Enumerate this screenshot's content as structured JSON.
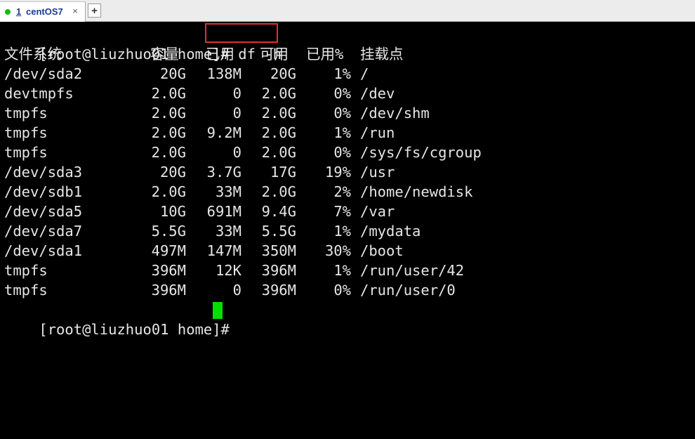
{
  "tab": {
    "number": "1",
    "title": "centOS7",
    "close_glyph": "×",
    "add_glyph": "+",
    "status_color": "#18b818"
  },
  "terminal": {
    "prompt": "[root@liuzhuo01 home]#",
    "command": "df -h",
    "headers": {
      "filesystem": "文件系统",
      "size": "容量",
      "used": "已用",
      "avail": "可用",
      "use_pct": "已用%",
      "mount": "挂载点"
    },
    "rows": [
      {
        "fs": "/dev/sda2",
        "size": "20G",
        "used": "138M",
        "avail": "20G",
        "pct": "1%",
        "mount": "/"
      },
      {
        "fs": "devtmpfs",
        "size": "2.0G",
        "used": "0",
        "avail": "2.0G",
        "pct": "0%",
        "mount": "/dev"
      },
      {
        "fs": "tmpfs",
        "size": "2.0G",
        "used": "0",
        "avail": "2.0G",
        "pct": "0%",
        "mount": "/dev/shm"
      },
      {
        "fs": "tmpfs",
        "size": "2.0G",
        "used": "9.2M",
        "avail": "2.0G",
        "pct": "1%",
        "mount": "/run"
      },
      {
        "fs": "tmpfs",
        "size": "2.0G",
        "used": "0",
        "avail": "2.0G",
        "pct": "0%",
        "mount": "/sys/fs/cgroup"
      },
      {
        "fs": "/dev/sda3",
        "size": "20G",
        "used": "3.7G",
        "avail": "17G",
        "pct": "19%",
        "mount": "/usr"
      },
      {
        "fs": "/dev/sdb1",
        "size": "2.0G",
        "used": "33M",
        "avail": "2.0G",
        "pct": "2%",
        "mount": "/home/newdisk"
      },
      {
        "fs": "/dev/sda5",
        "size": "10G",
        "used": "691M",
        "avail": "9.4G",
        "pct": "7%",
        "mount": "/var"
      },
      {
        "fs": "/dev/sda7",
        "size": "5.5G",
        "used": "33M",
        "avail": "5.5G",
        "pct": "1%",
        "mount": "/mydata"
      },
      {
        "fs": "/dev/sda1",
        "size": "497M",
        "used": "147M",
        "avail": "350M",
        "pct": "30%",
        "mount": "/boot"
      },
      {
        "fs": "tmpfs",
        "size": "396M",
        "used": "12K",
        "avail": "396M",
        "pct": "1%",
        "mount": "/run/user/42"
      },
      {
        "fs": "tmpfs",
        "size": "396M",
        "used": "0",
        "avail": "396M",
        "pct": "0%",
        "mount": "/run/user/0"
      }
    ],
    "final_prompt": "[root@liuzhuo01 home]#",
    "cursor_color": "#00e000",
    "highlight_color": "#e03030"
  }
}
